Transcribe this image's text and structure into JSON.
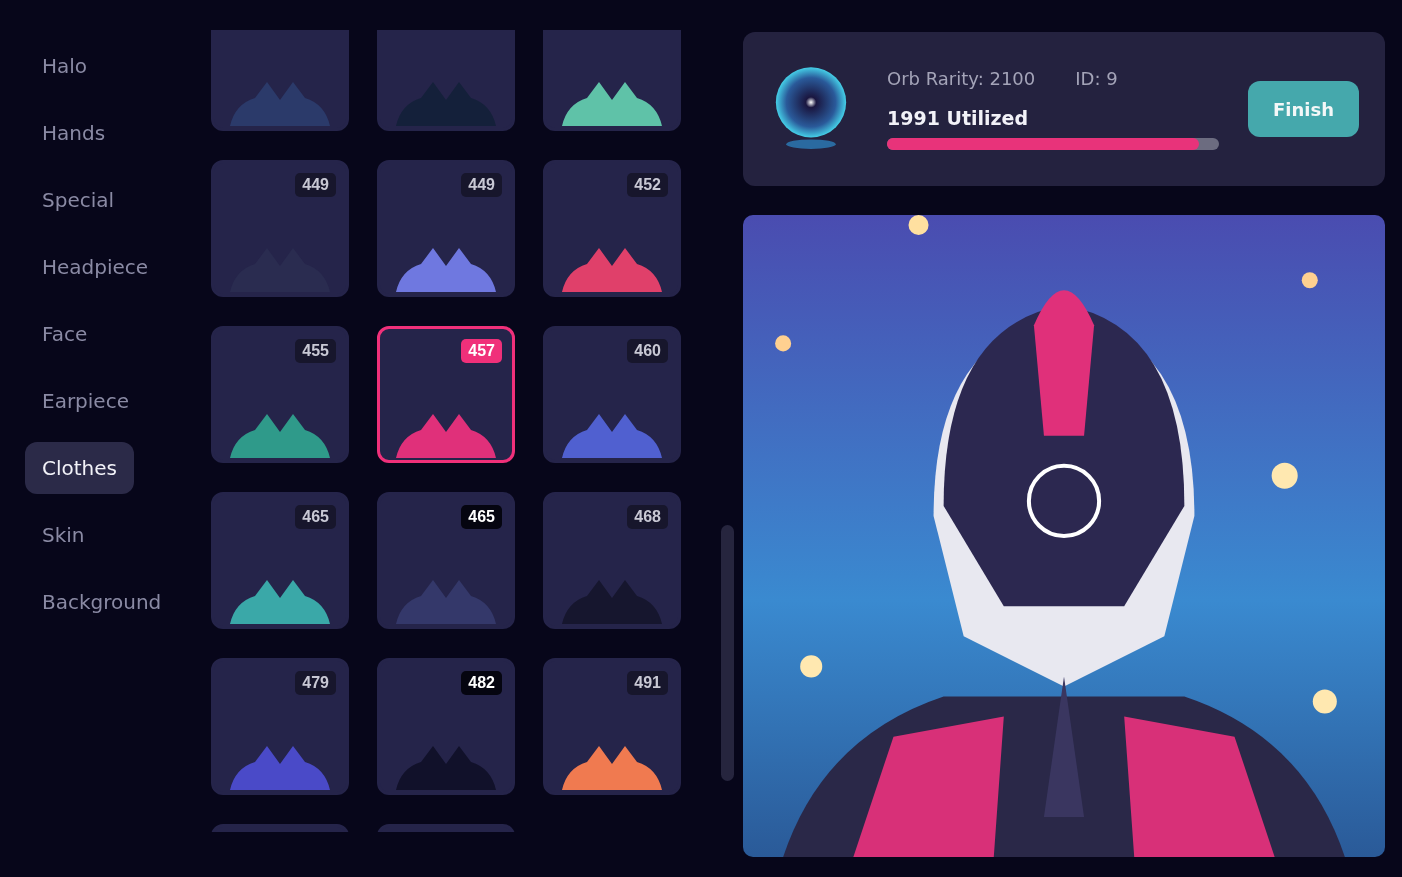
{
  "sidebar": {
    "items": [
      {
        "label": "Halo",
        "selected": false
      },
      {
        "label": "Hands",
        "selected": false
      },
      {
        "label": "Special",
        "selected": false
      },
      {
        "label": "Headpiece",
        "selected": false
      },
      {
        "label": "Face",
        "selected": false
      },
      {
        "label": "Earpiece",
        "selected": false
      },
      {
        "label": "Clothes",
        "selected": true
      },
      {
        "label": "Skin",
        "selected": false
      },
      {
        "label": "Background",
        "selected": false
      }
    ]
  },
  "grid": {
    "tiles": [
      {
        "color": "#2b3a6a",
        "selected": false
      },
      {
        "color": "#14203a",
        "selected": false
      },
      {
        "color": "#5fc2a8",
        "selected": false
      },
      {
        "label": "449",
        "color": "#2a2c50",
        "selected": false,
        "hovered": false
      },
      {
        "label": "449",
        "color": "#6f78e0",
        "selected": false,
        "hovered": false
      },
      {
        "label": "452",
        "color": "#e0406a",
        "selected": false,
        "hovered": false
      },
      {
        "label": "455",
        "color": "#2f9a8a",
        "selected": false,
        "hovered": false
      },
      {
        "label": "457",
        "color": "#e0307a",
        "selected": true,
        "hovered": false
      },
      {
        "label": "460",
        "color": "#5060d0",
        "selected": false,
        "hovered": false
      },
      {
        "label": "465",
        "color": "#3aa8a8",
        "selected": false,
        "hovered": false
      },
      {
        "label": "465",
        "color": "#34386a",
        "selected": false,
        "hovered": true
      },
      {
        "label": "468",
        "color": "#16162e",
        "selected": false,
        "hovered": false
      },
      {
        "label": "479",
        "color": "#4a4ac8",
        "selected": false,
        "hovered": false
      },
      {
        "label": "482",
        "color": "#11112a",
        "selected": false,
        "hovered": true
      },
      {
        "label": "491",
        "color": "#f07a50",
        "selected": false,
        "hovered": false
      },
      {
        "selected": false
      },
      {
        "selected": false
      }
    ]
  },
  "orb": {
    "rarity": "Orb Rarity: 2100",
    "id": "ID: 9",
    "utilized": "1991 Utilized",
    "level": 0.94
  },
  "finish_button": "Finish"
}
